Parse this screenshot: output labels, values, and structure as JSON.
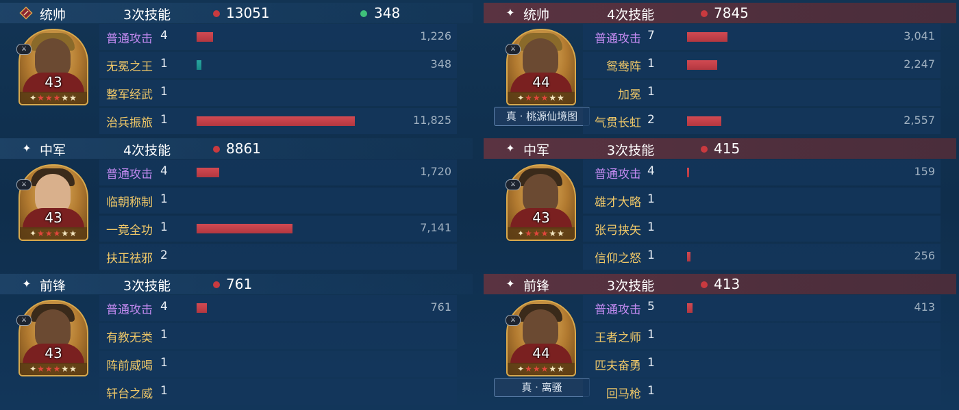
{
  "left": {
    "sections": [
      {
        "role": "统帅",
        "role_icon": "commander-diamond-icon",
        "skill_count": "3次技能",
        "damage": "13051",
        "heal": "348",
        "level": "43",
        "stars": "✦★★★★★",
        "treasure": "",
        "skills": [
          {
            "name": "普通攻击",
            "level": "4",
            "value": "1,226",
            "fraction": 0.104
          },
          {
            "name": "无冕之王",
            "level": "1",
            "value": "348",
            "fraction": 0.03
          },
          {
            "name": "整军经武",
            "level": "1",
            "value": "",
            "fraction": 0
          },
          {
            "name": "治兵振旅",
            "level": "1",
            "value": "11,825",
            "fraction": 1.0
          }
        ]
      },
      {
        "role": "中军",
        "role_icon": "sparkle-icon",
        "skill_count": "4次技能",
        "damage": "8861",
        "heal": "",
        "level": "43",
        "stars": "✦★★★★★",
        "treasure": "",
        "skills": [
          {
            "name": "普通攻击",
            "level": "4",
            "value": "1,720",
            "fraction": 0.145
          },
          {
            "name": "临朝称制",
            "level": "1",
            "value": "",
            "fraction": 0
          },
          {
            "name": "一竟全功",
            "level": "1",
            "value": "7,141",
            "fraction": 0.604
          },
          {
            "name": "扶正祛邪",
            "level": "2",
            "value": "",
            "fraction": 0
          }
        ]
      },
      {
        "role": "前锋",
        "role_icon": "sparkle-icon",
        "skill_count": "3次技能",
        "damage": "761",
        "heal": "",
        "level": "43",
        "stars": "✦★★★★★",
        "treasure": "",
        "skills": [
          {
            "name": "普通攻击",
            "level": "4",
            "value": "761",
            "fraction": 0.064
          },
          {
            "name": "有教无类",
            "level": "1",
            "value": "",
            "fraction": 0
          },
          {
            "name": "阵前威喝",
            "level": "1",
            "value": "",
            "fraction": 0
          },
          {
            "name": "轩台之威",
            "level": "1",
            "value": "",
            "fraction": 0
          }
        ]
      }
    ]
  },
  "right": {
    "sections": [
      {
        "role": "统帅",
        "role_icon": "sparkle-icon",
        "skill_count": "4次技能",
        "damage": "7845",
        "heal": "",
        "level": "44",
        "stars": "✦★★★★★",
        "treasure": "真 · 桃源仙境图",
        "skills": [
          {
            "name": "普通攻击",
            "level": "7",
            "value": "3,041",
            "fraction": 0.257
          },
          {
            "name": "鸳鸯阵",
            "level": "1",
            "value": "2,247",
            "fraction": 0.19
          },
          {
            "name": "加冕",
            "level": "1",
            "value": "",
            "fraction": 0
          },
          {
            "name": "气贯长虹",
            "level": "2",
            "value": "2,557",
            "fraction": 0.216
          }
        ]
      },
      {
        "role": "中军",
        "role_icon": "sparkle-icon",
        "skill_count": "3次技能",
        "damage": "415",
        "heal": "",
        "level": "43",
        "stars": "✦★★★★★",
        "treasure": "",
        "skills": [
          {
            "name": "普通攻击",
            "level": "4",
            "value": "159",
            "fraction": 0.013
          },
          {
            "name": "雄才大略",
            "level": "1",
            "value": "",
            "fraction": 0
          },
          {
            "name": "张弓挟矢",
            "level": "1",
            "value": "",
            "fraction": 0
          },
          {
            "name": "信仰之怒",
            "level": "1",
            "value": "256",
            "fraction": 0.022
          }
        ]
      },
      {
        "role": "前锋",
        "role_icon": "sparkle-icon",
        "skill_count": "3次技能",
        "damage": "413",
        "heal": "",
        "level": "44",
        "stars": "✦★★★★★",
        "treasure": "真 · 离骚",
        "skills": [
          {
            "name": "普通攻击",
            "level": "5",
            "value": "413",
            "fraction": 0.035
          },
          {
            "name": "王者之师",
            "level": "1",
            "value": "",
            "fraction": 0
          },
          {
            "name": "匹夫奋勇",
            "level": "1",
            "value": "",
            "fraction": 0
          },
          {
            "name": "回马枪",
            "level": "1",
            "value": "",
            "fraction": 0
          }
        ]
      }
    ]
  },
  "colors": {
    "damage_bar": "#c53f48",
    "heal_bar": "#1f9a94",
    "normal_attack": "#c28af0",
    "skill_name": "#f0c868",
    "enemy_header": "#55313f"
  }
}
